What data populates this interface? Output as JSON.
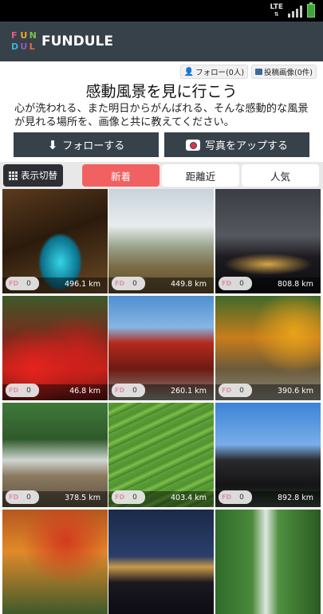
{
  "statusbar": {
    "network": "LTE"
  },
  "app": {
    "logo_letters": [
      "F",
      "U",
      "N",
      "D",
      "U",
      "L",
      "E"
    ],
    "title": "FUNDULE"
  },
  "counts": {
    "follow": "フォロー(0人)",
    "posts": "投稿画像(0件)"
  },
  "headline": "感動風景を見に行こう",
  "description": "心が洗われる、また明日からがんばれる、そんな感動的な風景が見れる場所を、画像と共に教えてください。",
  "buttons": {
    "follow": "フォローする",
    "upload": "写真をアップする"
  },
  "toolbar": {
    "toggle": "表示切替",
    "tabs": [
      "新着",
      "距離近",
      "人気"
    ],
    "active_tab": "新着"
  },
  "icons": {
    "follow": "person-icon",
    "posts": "image-icon",
    "follow_btn": "download-arrow-icon",
    "upload_btn": "camera-icon",
    "toggle": "grid-icon"
  },
  "colors": {
    "appbar": "#37414a",
    "active_tab": "#f26161",
    "logo": [
      "#e85b8a",
      "#f5a623",
      "#7fc241",
      "#3bb0e0",
      "#9b59b6",
      "#f26b3a"
    ]
  },
  "photos": [
    {
      "likes": "0",
      "distance": "496.1 km",
      "scene": "cave-river"
    },
    {
      "likes": "0",
      "distance": "449.8 km",
      "scene": "castle-ruins-sea-of-clouds"
    },
    {
      "likes": "0",
      "distance": "808.8 km",
      "scene": "city-night-view"
    },
    {
      "likes": "0",
      "distance": "46.8 km",
      "scene": "red-spider-lilies"
    },
    {
      "likes": "0",
      "distance": "260.1 km",
      "scene": "red-temple"
    },
    {
      "likes": "0",
      "distance": "390.6 km",
      "scene": "autumn-gorge-bridge"
    },
    {
      "likes": "0",
      "distance": "378.5 km",
      "scene": "mountain-stream"
    },
    {
      "likes": "0",
      "distance": "403.4 km",
      "scene": "terraced-rice-fields"
    },
    {
      "likes": "0",
      "distance": "892.8 km",
      "scene": "black-castle"
    },
    {
      "likes": "",
      "distance": "",
      "scene": "autumn-garden-lantern"
    },
    {
      "likes": "",
      "distance": "",
      "scene": "harbor-night-view"
    },
    {
      "likes": "",
      "distance": "",
      "scene": "green-waterfall"
    }
  ]
}
